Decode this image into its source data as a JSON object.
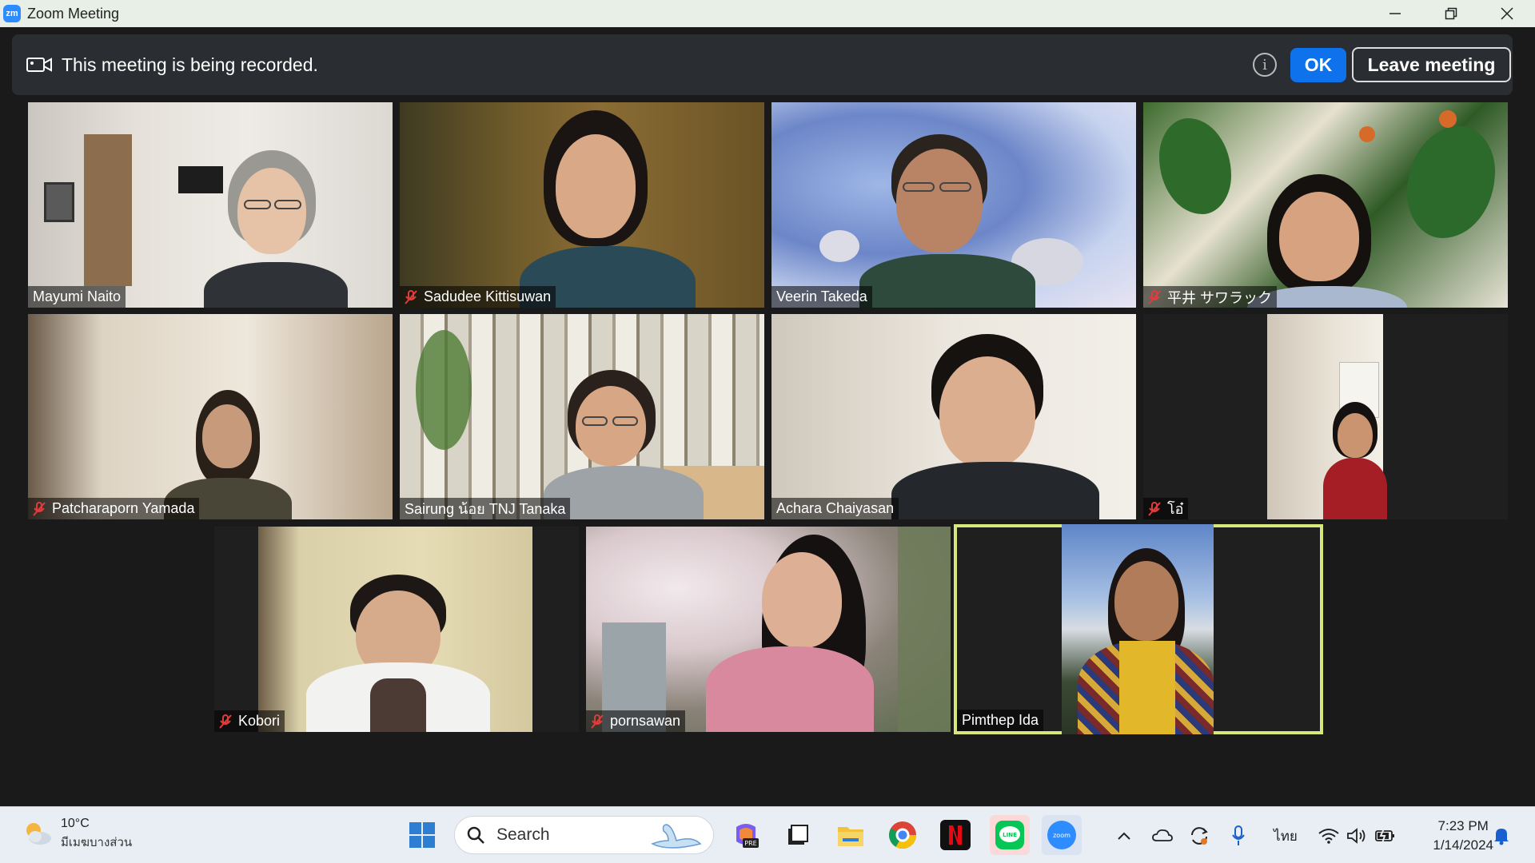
{
  "window": {
    "title": "Zoom Meeting",
    "logo_text": "zm"
  },
  "banner": {
    "message": "This meeting is being recorded.",
    "ok_label": "OK",
    "leave_label": "Leave meeting"
  },
  "participants": [
    {
      "name": "Mayumi Naito",
      "muted": false
    },
    {
      "name": "Sadudee Kittisuwan",
      "muted": true
    },
    {
      "name": "Veerin Takeda",
      "muted": false
    },
    {
      "name": "平井 サワラック",
      "muted": true
    },
    {
      "name": "Patcharaporn Yamada",
      "muted": true
    },
    {
      "name": "Sairung น้อย TNJ Tanaka",
      "muted": false
    },
    {
      "name": "Achara Chaiyasan",
      "muted": false
    },
    {
      "name": "โอ๋",
      "muted": true
    },
    {
      "name": "Kobori",
      "muted": true
    },
    {
      "name": "pornsawan",
      "muted": true
    },
    {
      "name": "Pimthep Ida",
      "muted": false,
      "active_speaker": true
    }
  ],
  "taskbar": {
    "weather_temp": "10°C",
    "weather_condition": "มีเมฆบางส่วน",
    "search_label": "Search",
    "language": "ไทย",
    "time": "7:23 PM",
    "date": "1/14/2024"
  },
  "colors": {
    "accent": "#0e72ed",
    "active_speaker_border": "#d8e77b",
    "banner_bg": "#2a2d31"
  }
}
